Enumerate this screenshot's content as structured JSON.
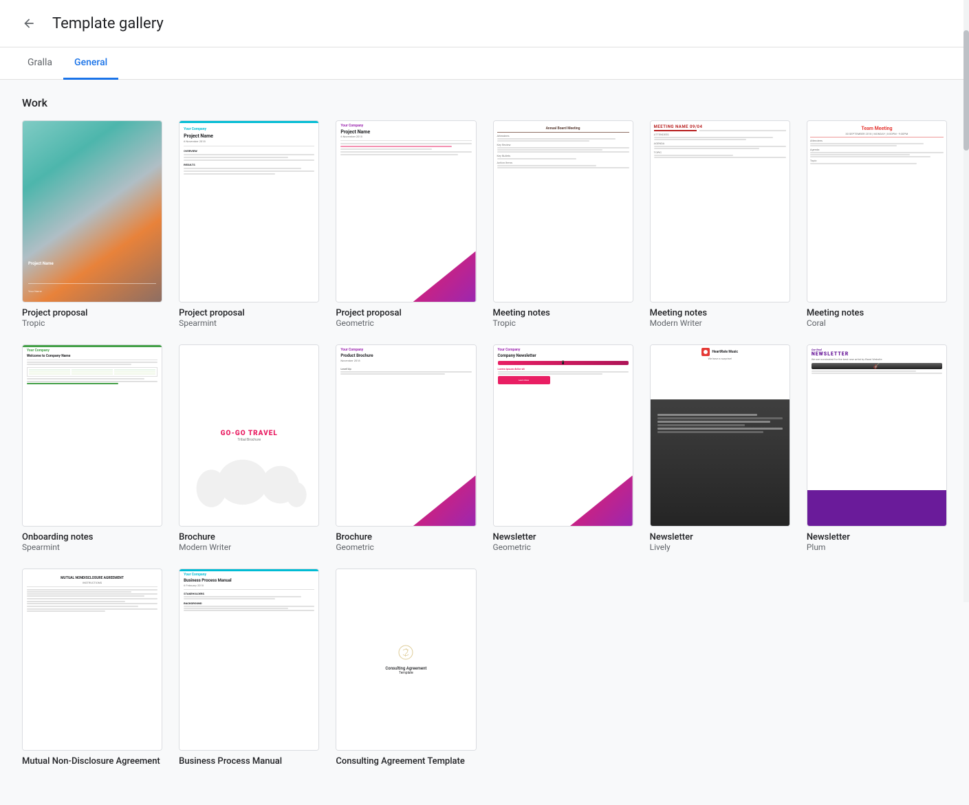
{
  "header": {
    "title": "Template gallery",
    "back_label": "←"
  },
  "tabs": [
    {
      "id": "gralla",
      "label": "Gralla",
      "active": false
    },
    {
      "id": "general",
      "label": "General",
      "active": true
    }
  ],
  "sections": [
    {
      "id": "work",
      "title": "Work",
      "templates": [
        {
          "id": "project-proposal-tropic",
          "name": "Project proposal",
          "sub": "Tropic",
          "style": "tropic"
        },
        {
          "id": "project-proposal-spearmint",
          "name": "Project proposal",
          "sub": "Spearmint",
          "style": "spearmint"
        },
        {
          "id": "project-proposal-geometric",
          "name": "Project proposal",
          "sub": "Geometric",
          "style": "geometric"
        },
        {
          "id": "meeting-notes-tropic",
          "name": "Meeting notes",
          "sub": "Tropic",
          "style": "meeting-tropic"
        },
        {
          "id": "meeting-notes-modern",
          "name": "Meeting notes",
          "sub": "Modern Writer",
          "style": "meeting-modern"
        },
        {
          "id": "meeting-notes-coral",
          "name": "Meeting notes",
          "sub": "Coral",
          "style": "meeting-coral"
        },
        {
          "id": "onboarding-notes",
          "name": "Onboarding notes",
          "sub": "Spearmint",
          "style": "onboarding"
        },
        {
          "id": "brochure-modern",
          "name": "Brochure",
          "sub": "Modern Writer",
          "style": "brochure-modern"
        },
        {
          "id": "brochure-geometric",
          "name": "Brochure",
          "sub": "Geometric",
          "style": "brochure-geo"
        },
        {
          "id": "newsletter-geometric",
          "name": "Newsletter",
          "sub": "Geometric",
          "style": "newsletter-geo"
        },
        {
          "id": "newsletter-lively",
          "name": "Newsletter",
          "sub": "Lively",
          "style": "newsletter-lively"
        },
        {
          "id": "newsletter-plum",
          "name": "Newsletter",
          "sub": "Plum",
          "style": "newsletter-plum"
        },
        {
          "id": "nda",
          "name": "Mutual Non-Disclosure Agreement",
          "sub": "",
          "style": "nda"
        },
        {
          "id": "business-process",
          "name": "Business Process Manual",
          "sub": "",
          "style": "business"
        },
        {
          "id": "consulting",
          "name": "Consulting Agreement Template",
          "sub": "",
          "style": "consulting"
        }
      ]
    }
  ],
  "scrollbar": {
    "visible": true
  }
}
